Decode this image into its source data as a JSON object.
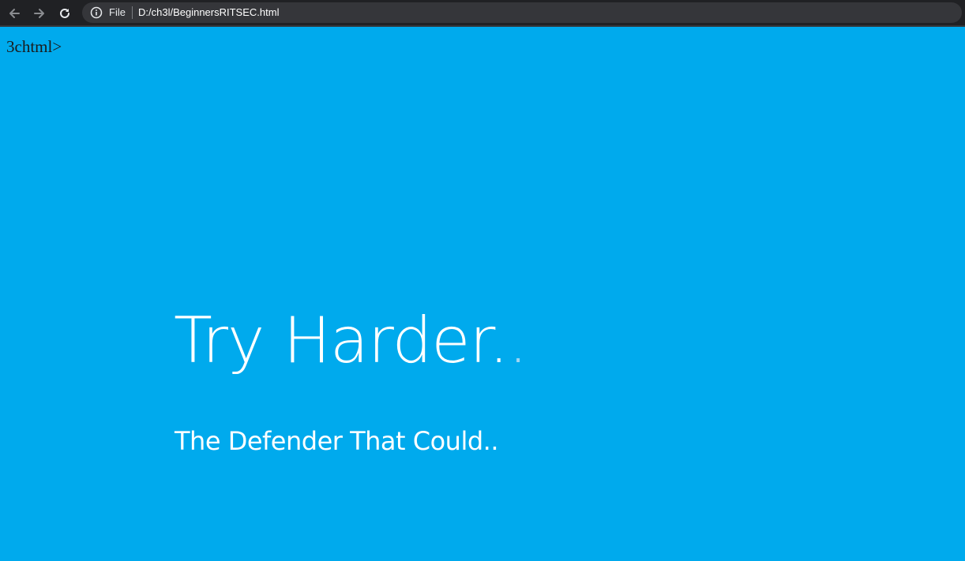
{
  "browser": {
    "address_bar": {
      "scheme_label": "File",
      "url": "D:/ch3l/BeginnersRITSEC.html"
    },
    "icons": {
      "back": "arrow-left-icon",
      "forward": "arrow-right-icon",
      "reload": "reload-icon",
      "site_info": "info-icon"
    },
    "colors": {
      "toolbar": "#202124",
      "omnibox": "#35363a"
    }
  },
  "page": {
    "background_color": "#00aaed",
    "stray_text": "3chtml>",
    "headline": {
      "main": "Try Harder.",
      "dots": "."
    },
    "subheadline": "The Defender That Could.."
  }
}
